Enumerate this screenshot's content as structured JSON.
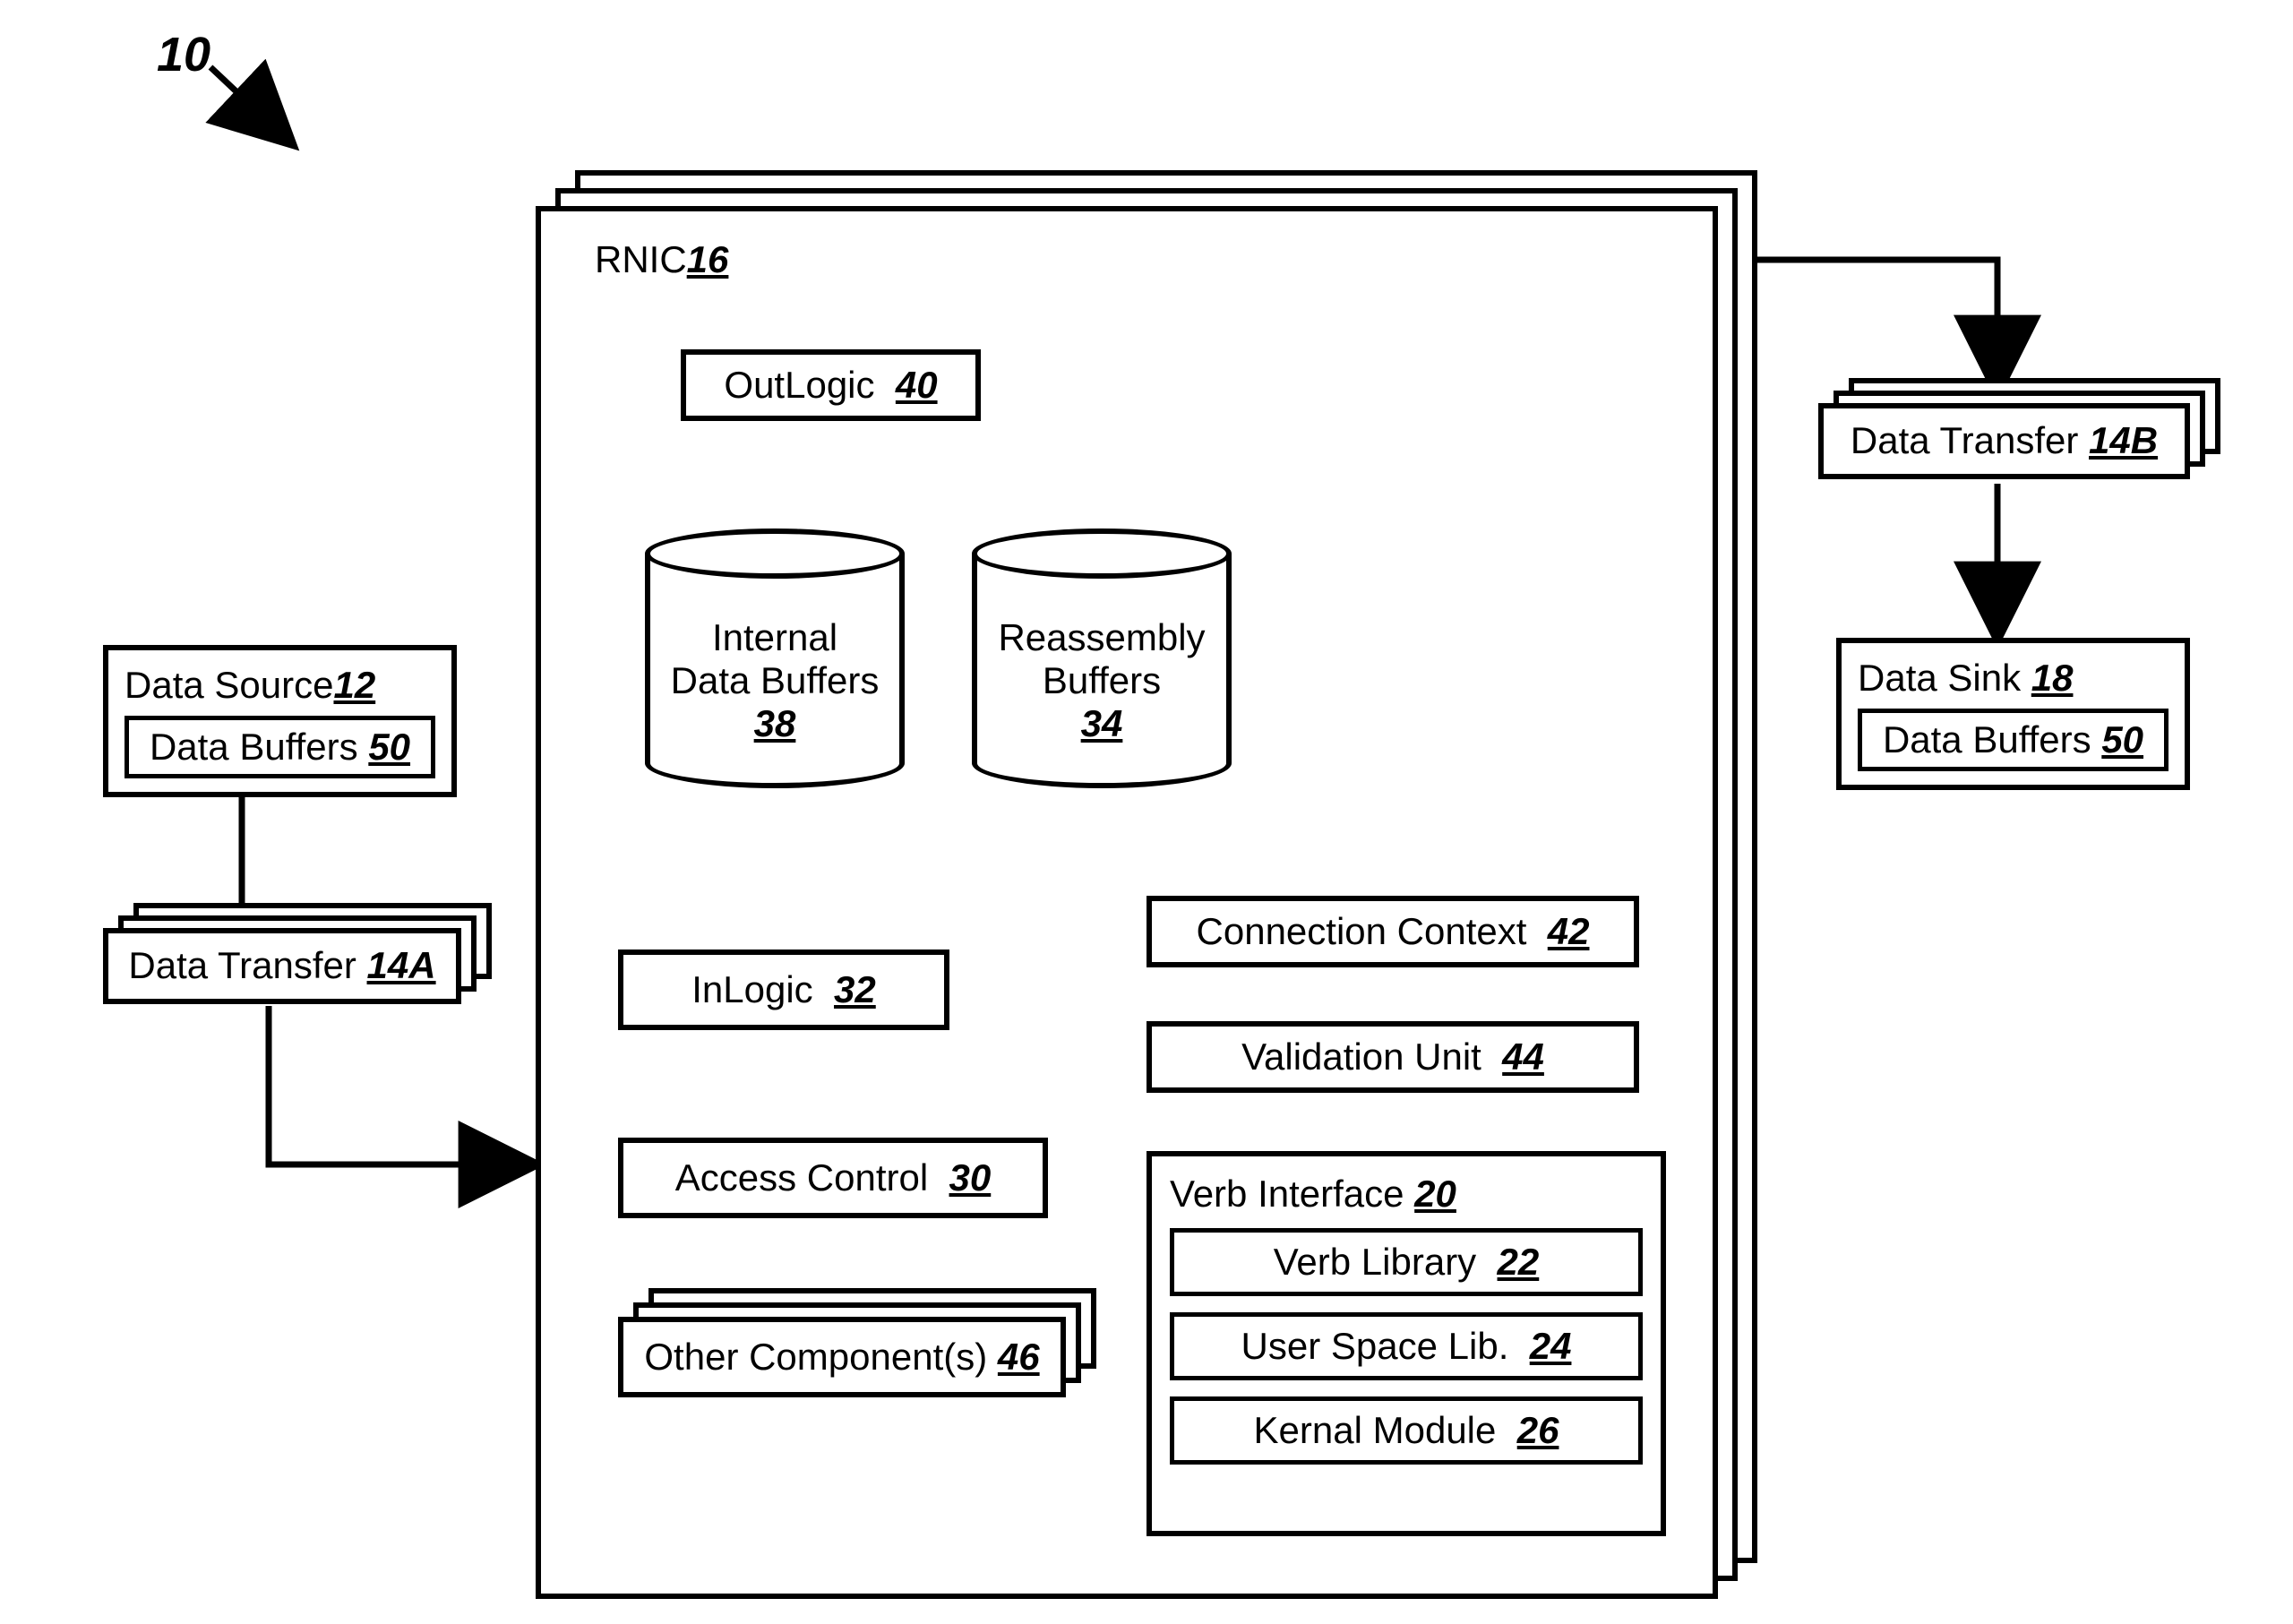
{
  "figure_ref": "10",
  "rnic": {
    "label": "RNIC",
    "ref": "16"
  },
  "outlogic": {
    "label": "OutLogic",
    "ref": "40"
  },
  "internal_buffers": {
    "line1": "Internal",
    "line2": "Data Buffers",
    "ref": "38"
  },
  "reassembly_buffers": {
    "line1": "Reassembly",
    "line2": "Buffers",
    "ref": "34"
  },
  "inlogic": {
    "label": "InLogic",
    "ref": "32"
  },
  "conn_ctx": {
    "label": "Connection Context",
    "ref": "42"
  },
  "validation": {
    "label": "Validation Unit",
    "ref": "44"
  },
  "access_ctrl": {
    "label": "Access Control",
    "ref": "30"
  },
  "other_components": {
    "label": "Other Component(s)",
    "ref": "46"
  },
  "verb_interface": {
    "label": "Verb Interface",
    "ref": "20"
  },
  "verb_library": {
    "label": "Verb Library",
    "ref": "22"
  },
  "user_space_lib": {
    "label": "User Space Lib.",
    "ref": "24"
  },
  "kernal_module": {
    "label": "Kernal Module",
    "ref": "26"
  },
  "data_source": {
    "label": "Data Source",
    "ref": "12"
  },
  "data_buffers_left": {
    "label": "Data Buffers",
    "ref": "50"
  },
  "data_transfer_left": {
    "label": "Data Transfer",
    "ref": "14A"
  },
  "data_transfer_right": {
    "label": "Data Transfer",
    "ref": "14B"
  },
  "data_sink": {
    "label": "Data Sink",
    "ref": "18"
  },
  "data_buffers_right": {
    "label": "Data Buffers",
    "ref": "50"
  }
}
